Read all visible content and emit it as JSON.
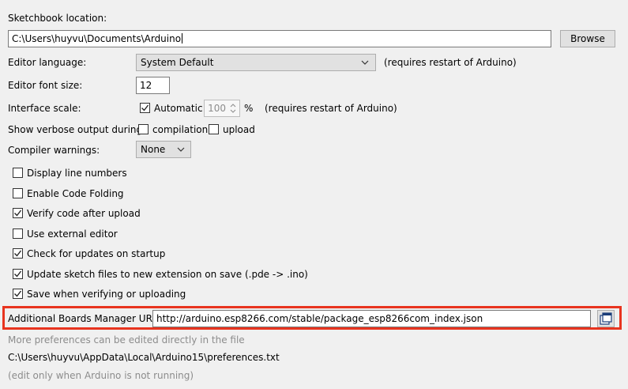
{
  "sketchbook": {
    "label": "Sketchbook location:",
    "path": "C:\\Users\\huyvu\\Documents\\Arduino",
    "browse_label": "Browse"
  },
  "editor_language": {
    "label": "Editor language:",
    "value": "System Default",
    "note": "(requires restart of Arduino)"
  },
  "editor_font_size": {
    "label": "Editor font size:",
    "value": "12"
  },
  "interface_scale": {
    "label": "Interface scale:",
    "automatic_label": "Automatic",
    "automatic_checked": true,
    "scale_value": "100",
    "percent": "%",
    "note": "(requires restart of Arduino)"
  },
  "verbose": {
    "label": "Show verbose output during:",
    "compilation_label": "compilation",
    "compilation_checked": false,
    "upload_label": "upload",
    "upload_checked": false
  },
  "compiler_warnings": {
    "label": "Compiler warnings:",
    "value": "None"
  },
  "options": [
    {
      "label": "Display line numbers",
      "checked": false
    },
    {
      "label": "Enable Code Folding",
      "checked": false
    },
    {
      "label": "Verify code after upload",
      "checked": true
    },
    {
      "label": "Use external editor",
      "checked": false
    },
    {
      "label": "Check for updates on startup",
      "checked": true
    },
    {
      "label": "Update sketch files to new extension on save (.pde -> .ino)",
      "checked": true
    },
    {
      "label": "Save when verifying or uploading",
      "checked": true
    }
  ],
  "boards_manager": {
    "label": "Additional Boards Manager URLs:",
    "value": "http://arduino.esp8266.com/stable/package_esp8266com_index.json",
    "highlight_color": "#e8341f"
  },
  "footer": {
    "more_prefs": "More preferences can be edited directly in the file",
    "prefs_path": "C:\\Users\\huyvu\\AppData\\Local\\Arduino15\\preferences.txt",
    "edit_note": "(edit only when Arduino is not running)"
  }
}
